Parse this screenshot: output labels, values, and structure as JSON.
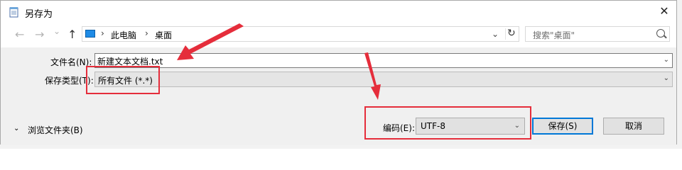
{
  "window": {
    "title": "另存为",
    "close_glyph": "✕"
  },
  "nav": {
    "back_glyph": "←",
    "forward_glyph": "→",
    "history_glyph": "⌄",
    "up_glyph": "↑",
    "breadcrumb": [
      "此电脑",
      "桌面"
    ],
    "breadcrumb_sep": "›",
    "refresh_glyph": "↻",
    "search_placeholder": "搜索\"桌面\""
  },
  "form": {
    "filename_label": "文件名(N):",
    "filename_value": "新建文本文档.txt",
    "filetype_label": "保存类型(T):",
    "filetype_value": "所有文件  (*.*)",
    "dropdown_glyph": "⌄"
  },
  "footer": {
    "browse_toggle_glyph": "⌄",
    "browse_label": "浏览文件夹(B)",
    "encoding_label": "编码(E):",
    "encoding_value": "UTF-8",
    "save_label": "保存(S)",
    "cancel_label": "取消"
  },
  "annotation_color": "#e52d3b",
  "accent_color": "#0078d7"
}
